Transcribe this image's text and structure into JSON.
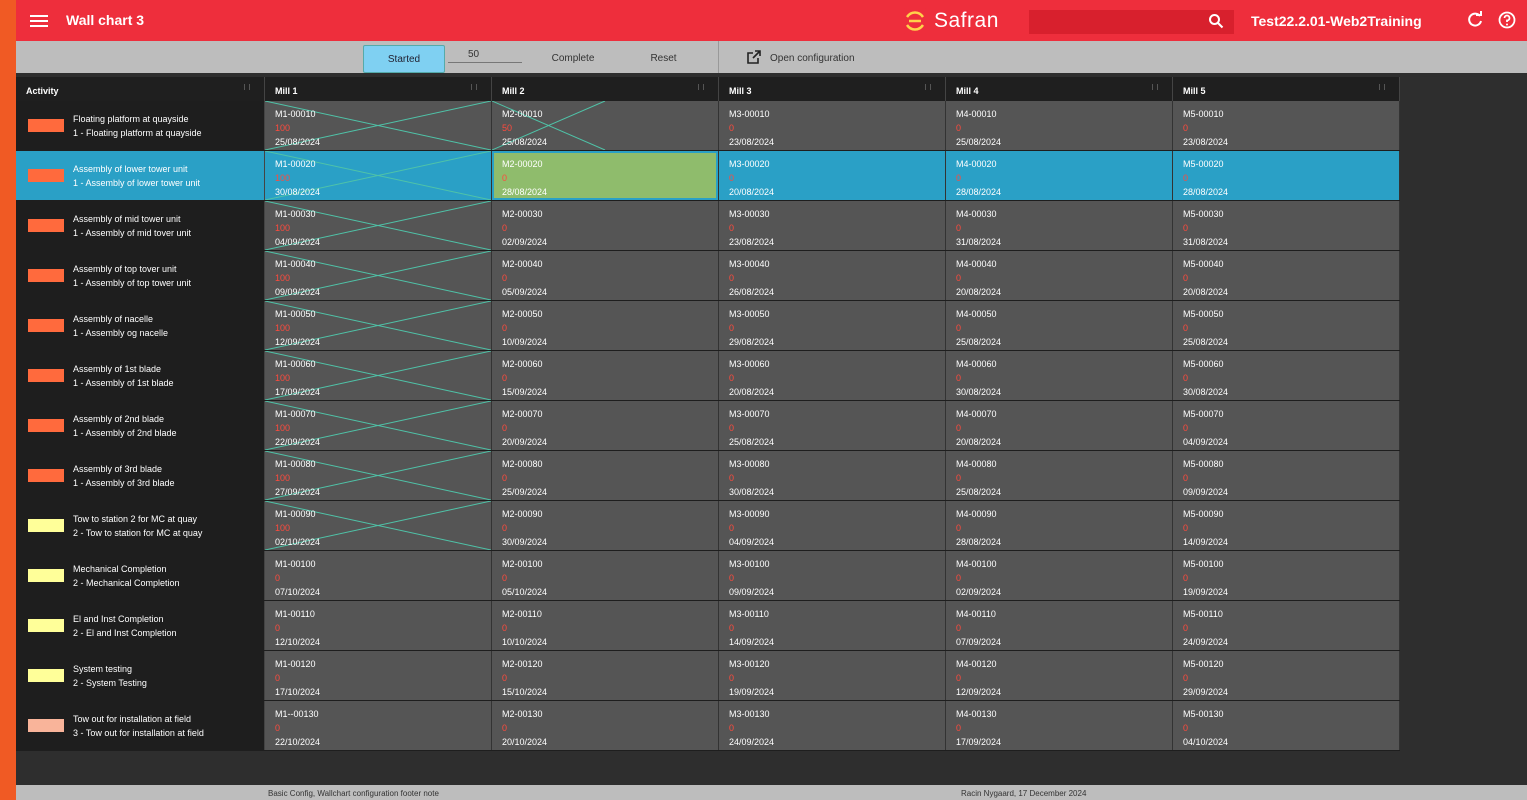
{
  "app": {
    "title": "Wall chart 3",
    "logo": "Safran",
    "user": "Test22.2.01-Web2Training"
  },
  "toolbar": {
    "started_label": "Started",
    "started_value": "50",
    "complete_label": "Complete",
    "reset_label": "Reset",
    "open_config_label": "Open configuration"
  },
  "columns": [
    "Activity",
    "Mill 1",
    "Mill 2",
    "Mill 3",
    "Mill 4",
    "Mill 5"
  ],
  "rows": [
    {
      "name": "Floating platform at quayside",
      "desc": "1 - Floating platform at quayside",
      "color": "#ff6a3d",
      "cells": [
        [
          "M1-00010",
          "100",
          "25/08/2024"
        ],
        [
          "M2-00010",
          "50",
          "25/08/2024"
        ],
        [
          "M3-00010",
          "0",
          "23/08/2024"
        ],
        [
          "M4-00010",
          "0",
          "25/08/2024"
        ],
        [
          "M5-00010",
          "0",
          "23/08/2024"
        ]
      ]
    },
    {
      "name": "Assembly of lower tower unit",
      "desc": "1 - Assembly of lower tower unit",
      "color": "#ff6a3d",
      "cells": [
        [
          "M1-00020",
          "100",
          "30/08/2024"
        ],
        [
          "M2-00020",
          "0",
          "28/08/2024"
        ],
        [
          "M3-00020",
          "0",
          "20/08/2024"
        ],
        [
          "M4-00020",
          "0",
          "28/08/2024"
        ],
        [
          "M5-00020",
          "0",
          "28/08/2024"
        ]
      ]
    },
    {
      "name": "Assembly of mid tower unit",
      "desc": "1 - Assembly of mid tover unit",
      "color": "#ff6a3d",
      "cells": [
        [
          "M1-00030",
          "100",
          "04/09/2024"
        ],
        [
          "M2-00030",
          "0",
          "02/09/2024"
        ],
        [
          "M3-00030",
          "0",
          "23/08/2024"
        ],
        [
          "M4-00030",
          "0",
          "31/08/2024"
        ],
        [
          "M5-00030",
          "0",
          "31/08/2024"
        ]
      ]
    },
    {
      "name": "Assembly of top tover unit",
      "desc": "1 - Assembly of top tower unit",
      "color": "#ff6a3d",
      "cells": [
        [
          "M1-00040",
          "100",
          "09/09/2024"
        ],
        [
          "M2-00040",
          "0",
          "05/09/2024"
        ],
        [
          "M3-00040",
          "0",
          "26/08/2024"
        ],
        [
          "M4-00040",
          "0",
          "20/08/2024"
        ],
        [
          "M5-00040",
          "0",
          "20/08/2024"
        ]
      ]
    },
    {
      "name": "Assembly of nacelle",
      "desc": "1 - Assembly og nacelle",
      "color": "#ff6a3d",
      "cells": [
        [
          "M1-00050",
          "100",
          "12/09/2024"
        ],
        [
          "M2-00050",
          "0",
          "10/09/2024"
        ],
        [
          "M3-00050",
          "0",
          "29/08/2024"
        ],
        [
          "M4-00050",
          "0",
          "25/08/2024"
        ],
        [
          "M5-00050",
          "0",
          "25/08/2024"
        ]
      ]
    },
    {
      "name": "Assembly of  1st blade",
      "desc": "1 - Assembly of 1st blade",
      "color": "#ff6a3d",
      "cells": [
        [
          "M1-00060",
          "100",
          "17/09/2024"
        ],
        [
          "M2-00060",
          "0",
          "15/09/2024"
        ],
        [
          "M3-00060",
          "0",
          "20/08/2024"
        ],
        [
          "M4-00060",
          "0",
          "30/08/2024"
        ],
        [
          "M5-00060",
          "0",
          "30/08/2024"
        ]
      ]
    },
    {
      "name": "Assembly of 2nd blade",
      "desc": "1 - Assembly of 2nd blade",
      "color": "#ff6a3d",
      "cells": [
        [
          "M1-00070",
          "100",
          "22/09/2024"
        ],
        [
          "M2-00070",
          "0",
          "20/09/2024"
        ],
        [
          "M3-00070",
          "0",
          "25/08/2024"
        ],
        [
          "M4-00070",
          "0",
          "20/08/2024"
        ],
        [
          "M5-00070",
          "0",
          "04/09/2024"
        ]
      ]
    },
    {
      "name": "Assembly of 3rd blade",
      "desc": "1 - Assembly of 3rd blade",
      "color": "#ff6a3d",
      "cells": [
        [
          "M1-00080",
          "100",
          "27/09/2024"
        ],
        [
          "M2-00080",
          "0",
          "25/09/2024"
        ],
        [
          "M3-00080",
          "0",
          "30/08/2024"
        ],
        [
          "M4-00080",
          "0",
          "25/08/2024"
        ],
        [
          "M5-00080",
          "0",
          "09/09/2024"
        ]
      ]
    },
    {
      "name": "Tow to station 2 for MC at quay",
      "desc": "2 - Tow to station for MC at quay",
      "color": "#ffff99",
      "cells": [
        [
          "M1-00090",
          "100",
          "02/10/2024"
        ],
        [
          "M2-00090",
          "0",
          "30/09/2024"
        ],
        [
          "M3-00090",
          "0",
          "04/09/2024"
        ],
        [
          "M4-00090",
          "0",
          "28/08/2024"
        ],
        [
          "M5-00090",
          "0",
          "14/09/2024"
        ]
      ]
    },
    {
      "name": "Mechanical Completion",
      "desc": "2 - Mechanical Completion",
      "color": "#ffff99",
      "cells": [
        [
          "M1-00100",
          "0",
          "07/10/2024"
        ],
        [
          "M2-00100",
          "0",
          "05/10/2024"
        ],
        [
          "M3-00100",
          "0",
          "09/09/2024"
        ],
        [
          "M4-00100",
          "0",
          "02/09/2024"
        ],
        [
          "M5-00100",
          "0",
          "19/09/2024"
        ]
      ]
    },
    {
      "name": "El and Inst Completion",
      "desc": "2 - El and Inst Completion",
      "color": "#ffff99",
      "cells": [
        [
          "M1-00110",
          "0",
          "12/10/2024"
        ],
        [
          "M2-00110",
          "0",
          "10/10/2024"
        ],
        [
          "M3-00110",
          "0",
          "14/09/2024"
        ],
        [
          "M4-00110",
          "0",
          "07/09/2024"
        ],
        [
          "M5-00110",
          "0",
          "24/09/2024"
        ]
      ]
    },
    {
      "name": "System testing",
      "desc": "2 - System Testing",
      "color": "#ffff99",
      "cells": [
        [
          "M1-00120",
          "0",
          "17/10/2024"
        ],
        [
          "M2-00120",
          "0",
          "15/10/2024"
        ],
        [
          "M3-00120",
          "0",
          "19/09/2024"
        ],
        [
          "M4-00120",
          "0",
          "12/09/2024"
        ],
        [
          "M5-00120",
          "0",
          "29/09/2024"
        ]
      ]
    },
    {
      "name": "Tow out for installation at field",
      "desc": "3 - Tow out for installation at field",
      "color": "#f9b49a",
      "cells": [
        [
          "M1--00130",
          "0",
          "22/10/2024"
        ],
        [
          "M2-00130",
          "0",
          "20/10/2024"
        ],
        [
          "M3-00130",
          "0",
          "24/09/2024"
        ],
        [
          "M4-00130",
          "0",
          "17/09/2024"
        ],
        [
          "M5-00130",
          "0",
          "04/10/2024"
        ]
      ]
    }
  ],
  "footer": {
    "left": "Basic Config, Wallchart configuration footer note",
    "right": "Racin Nygaard, 17 December 2024"
  }
}
